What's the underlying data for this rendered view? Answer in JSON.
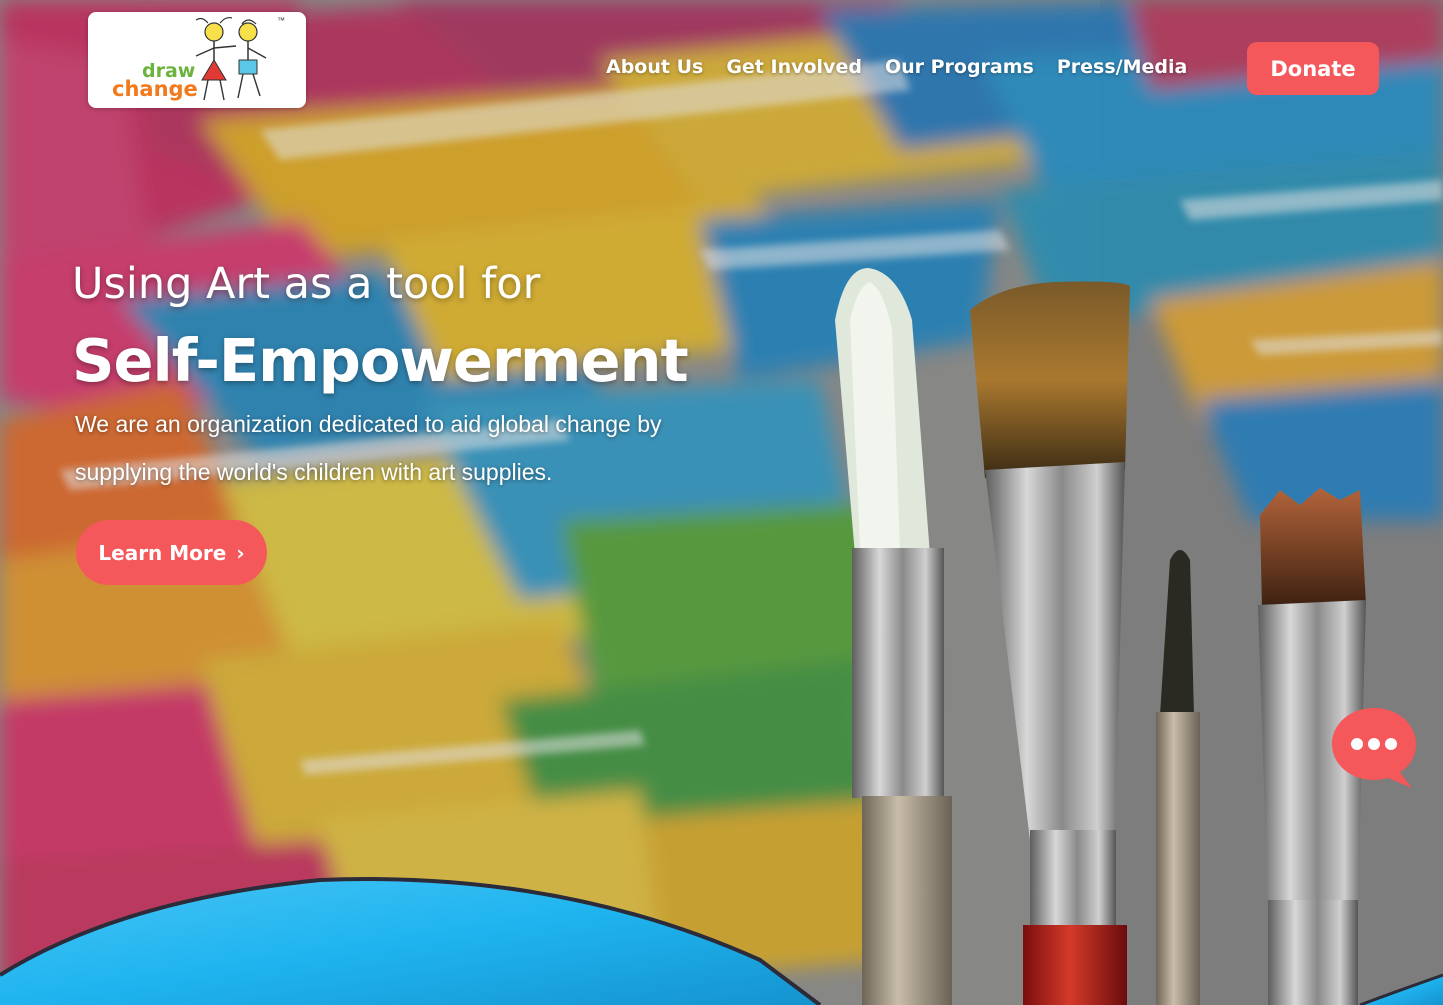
{
  "brand": {
    "logo_word_top": "draw",
    "logo_word_bottom": "change",
    "logo_tm": "™"
  },
  "nav": {
    "items": [
      {
        "label": "About Us"
      },
      {
        "label": "Get Involved"
      },
      {
        "label": "Our Programs"
      },
      {
        "label": "Press/Media"
      }
    ],
    "donate_label": "Donate"
  },
  "hero": {
    "line1": "Using Art as a tool for",
    "line2": "Self-Empowerment",
    "description": "We are an organization dedicated to aid global change by supplying the world's children with art supplies.",
    "cta_label": "Learn More",
    "cta_icon": "chevron-right-icon"
  },
  "chat": {
    "icon": "chat-bubble-icon"
  },
  "colors": {
    "accent": "#f4585a",
    "wave_blue": "#1fb4ef",
    "logo_green": "#6db33f",
    "logo_orange": "#f2791c"
  }
}
